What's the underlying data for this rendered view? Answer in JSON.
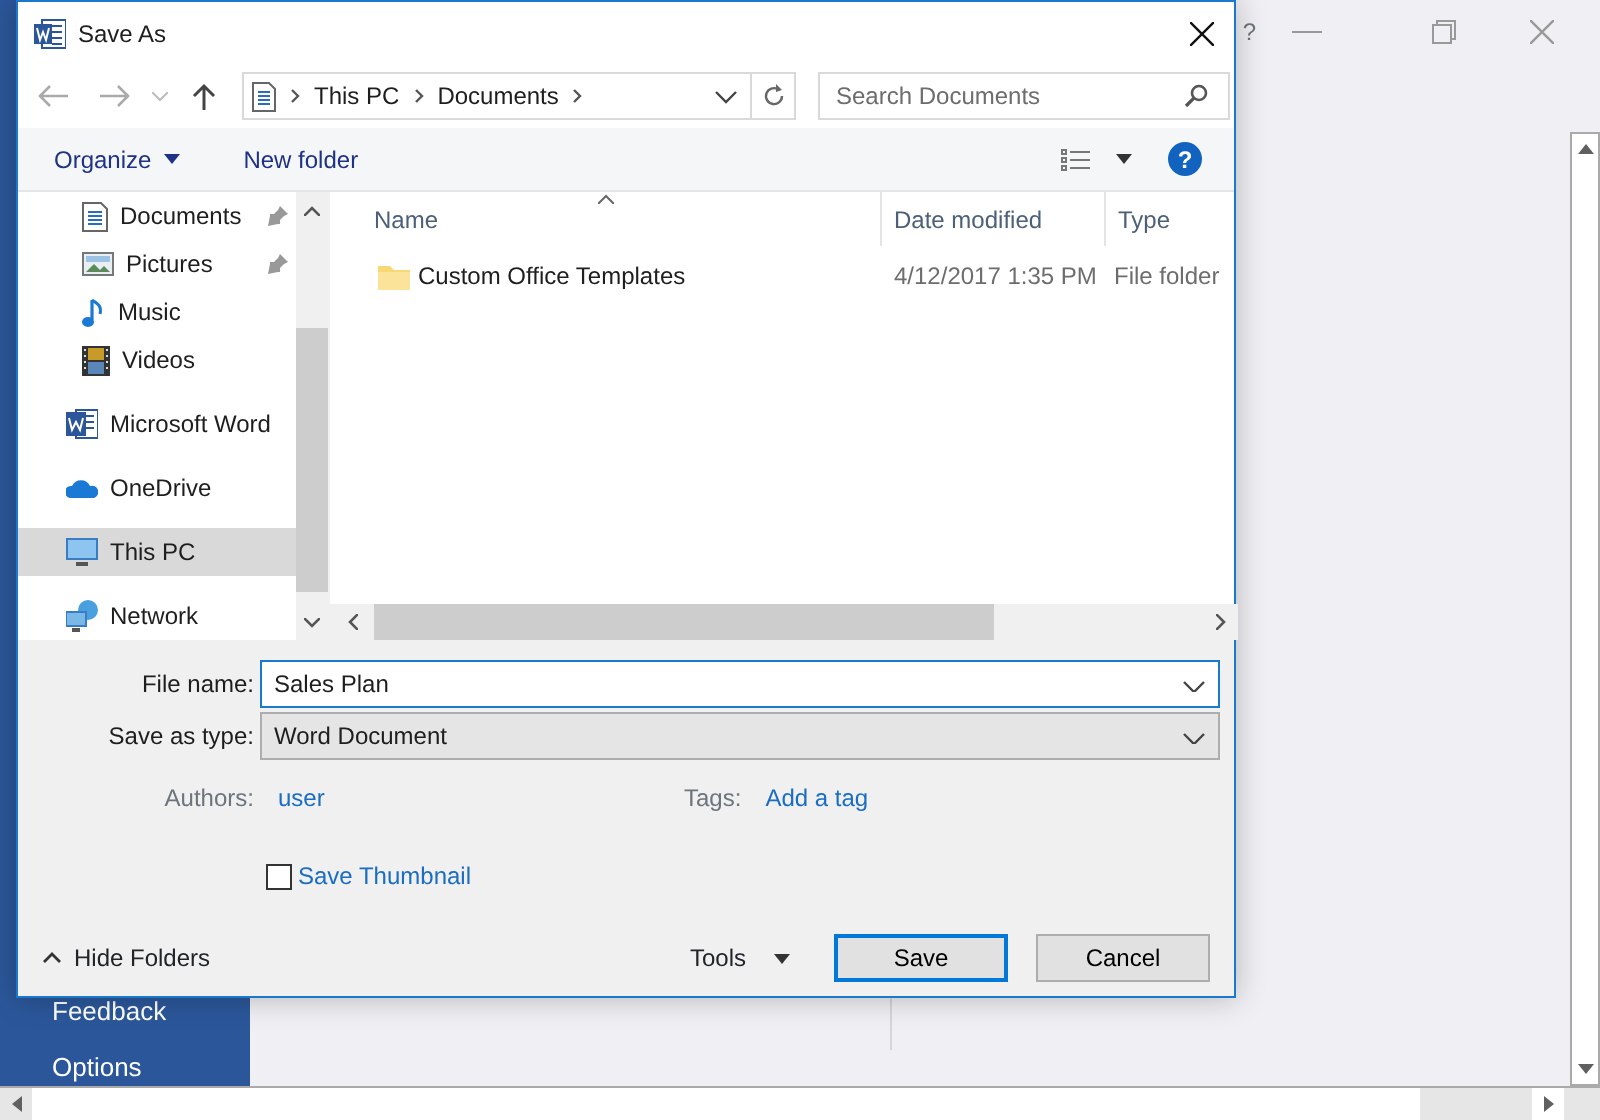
{
  "app": {
    "help_label": "?",
    "sidebar": [
      {
        "label": "Feedback"
      },
      {
        "label": "Options"
      }
    ]
  },
  "dialog": {
    "title": "Save As",
    "address": {
      "path": [
        "This PC",
        "Documents"
      ]
    },
    "search": {
      "placeholder": "Search Documents"
    },
    "toolbar": {
      "organize": "Organize",
      "new_folder": "New folder",
      "help_label": "?"
    },
    "nav_pane": {
      "quick_access": [
        {
          "label": "Documents",
          "kind": "documents",
          "pinned": true,
          "selected": false
        },
        {
          "label": "Pictures",
          "kind": "pictures",
          "pinned": true,
          "selected": false
        },
        {
          "label": "Music",
          "kind": "music",
          "pinned": false,
          "selected": false
        },
        {
          "label": "Videos",
          "kind": "videos",
          "pinned": false,
          "selected": false
        }
      ],
      "locations": [
        {
          "label": "Microsoft Word",
          "kind": "word",
          "selected": false
        },
        {
          "label": "OneDrive",
          "kind": "cloud",
          "selected": false
        },
        {
          "label": "This PC",
          "kind": "pc",
          "selected": true
        },
        {
          "label": "Network",
          "kind": "network",
          "selected": false
        }
      ]
    },
    "file_list": {
      "columns": [
        {
          "label": "Name",
          "sorted": true
        },
        {
          "label": "Date modified",
          "sorted": false
        },
        {
          "label": "Type",
          "sorted": false
        }
      ],
      "rows": [
        {
          "kind": "folder",
          "name": "Custom Office Templates",
          "date_modified": "4/12/2017 1:35 PM",
          "type": "File folder",
          "selected": false
        }
      ]
    },
    "file_name": {
      "label": "File name:",
      "value": "Sales Plan"
    },
    "save_as_type": {
      "label": "Save as type:",
      "value": "Word Document"
    },
    "authors": {
      "label": "Authors:",
      "value": "user"
    },
    "tags": {
      "label": "Tags:",
      "value": "Add a tag"
    },
    "save_thumbnail": {
      "label": "Save Thumbnail",
      "checked": false
    },
    "hide_folders": "Hide Folders",
    "tools": "Tools",
    "buttons": [
      {
        "label": "Save",
        "default": true
      },
      {
        "label": "Cancel",
        "default": false
      }
    ]
  }
}
